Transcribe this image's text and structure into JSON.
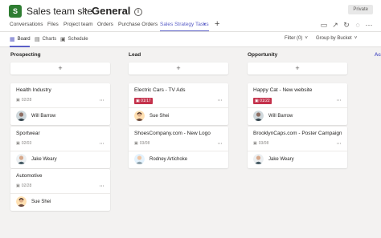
{
  "header": {
    "team_initial": "S",
    "team_name": "Sales team site",
    "separator": ">",
    "channel_name": "General",
    "private_label": "Private"
  },
  "tabs": [
    {
      "label": "Conversations"
    },
    {
      "label": "Files"
    },
    {
      "label": "Project team"
    },
    {
      "label": "Orders"
    },
    {
      "label": "Purchase Orders"
    },
    {
      "label": "Sales Strategy Tasks"
    }
  ],
  "toolbar": {
    "board_label": "Board",
    "charts_label": "Charts",
    "schedule_label": "Schedule",
    "filter_label": "Filter (0)",
    "group_label": "Group by Bucket"
  },
  "columns": [
    {
      "title": "Prospecting",
      "add_label": "+",
      "cards": [
        {
          "title": "Health Industry",
          "date": "02/28",
          "overdue": false,
          "assignee": "Will Barrow"
        },
        {
          "title": "Sportwear",
          "date": "02/03",
          "overdue": false,
          "assignee": "Jake Weary"
        },
        {
          "title": "Automotive",
          "date": "02/28",
          "overdue": false,
          "assignee": "Sue Shei"
        }
      ]
    },
    {
      "title": "Lead",
      "add_label": "+",
      "cards": [
        {
          "title": "Electric Cars - TV Ads",
          "date": "01/17",
          "overdue": true,
          "assignee": "Sue Shei"
        },
        {
          "title": "ShoesCompany.com - New Logo",
          "date": "03/08",
          "overdue": false,
          "assignee": "Rodney Artichoke"
        }
      ]
    },
    {
      "title": "Opportunity",
      "add_label": "+",
      "cards": [
        {
          "title": "Happy Cat - New website",
          "date": "01/22",
          "overdue": true,
          "assignee": "Will Barrow"
        },
        {
          "title": "BrooklynCaps.com - Poster Campaign",
          "date": "03/08",
          "overdue": false,
          "assignee": "Jake Weary"
        }
      ]
    }
  ],
  "overflow_column_initial": "Ac",
  "colors": {
    "accent": "#5b5fc7",
    "overdue": "#c4314b",
    "team": "#2e7d32"
  }
}
